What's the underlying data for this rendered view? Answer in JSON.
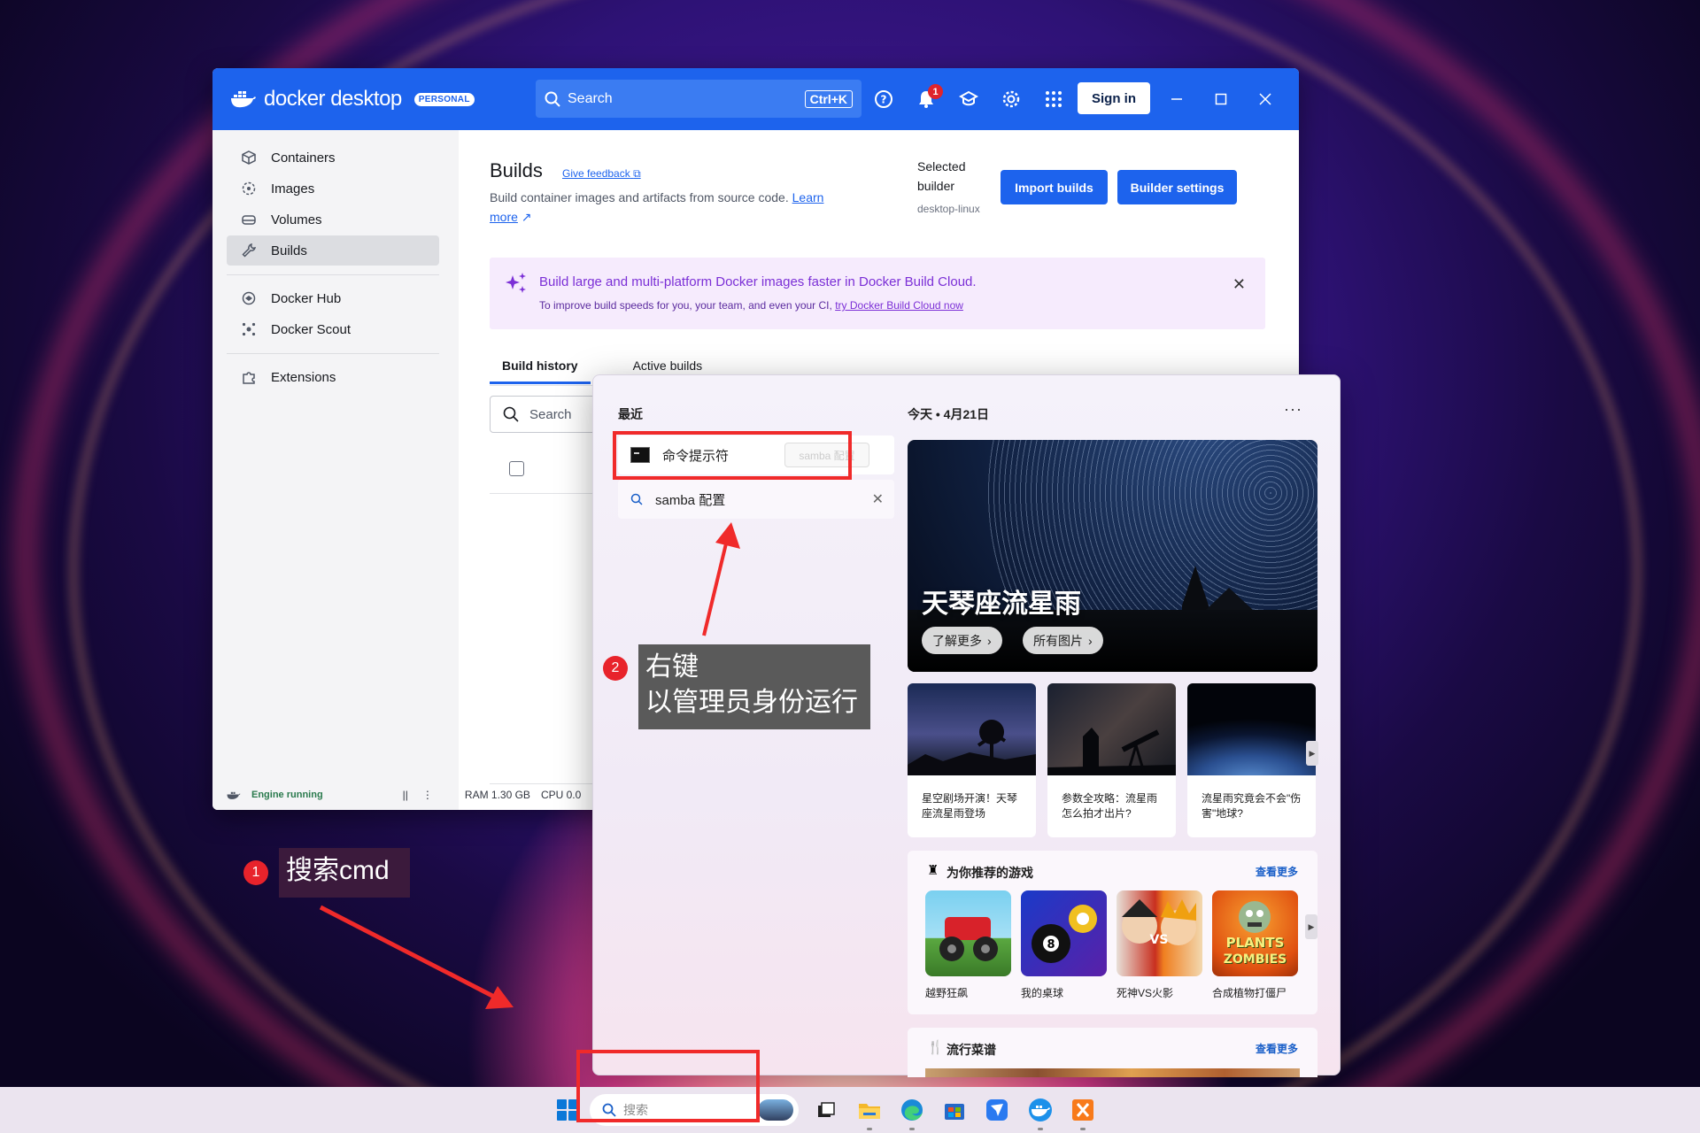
{
  "docker": {
    "logo_text": "docker desktop",
    "badge": "PERSONAL",
    "search_label": "Search",
    "search_shortcut": "Ctrl+K",
    "notification_count": "1",
    "signin_label": "Sign in",
    "sidebar": [
      {
        "label": "Containers",
        "icon": "container-icon"
      },
      {
        "label": "Images",
        "icon": "images-icon"
      },
      {
        "label": "Volumes",
        "icon": "volumes-icon"
      },
      {
        "label": "Builds",
        "icon": "builds-wrench-icon",
        "active": true
      },
      {
        "label": "Docker Hub",
        "icon": "docker-hub-icon"
      },
      {
        "label": "Docker Scout",
        "icon": "docker-scout-icon"
      },
      {
        "label": "Extensions",
        "icon": "extensions-puzzle-icon"
      }
    ],
    "status": {
      "engine": "Engine running",
      "pause": "||",
      "menu": "⋮",
      "ram": "RAM 1.30 GB",
      "cpu": "CPU 0.0"
    },
    "builds": {
      "title": "Builds",
      "feedback": "Give feedback",
      "desc_text": "Build container images and artifacts from source code.",
      "learn_more": "Learn more",
      "selected_builder_label": "Selected builder",
      "selected_builder_value": "desktop-linux",
      "import_btn": "Import builds",
      "settings_btn": "Builder settings",
      "banner_title": "Build large and multi-platform Docker images faster in Docker Build Cloud.",
      "banner_sub": "To improve build speeds for you, your team, and even your CI,",
      "banner_link": "try Docker Build Cloud now",
      "tabs": [
        "Build history",
        "Active builds"
      ],
      "search_placeholder": "Search"
    }
  },
  "start": {
    "recent_label": "最近",
    "recent_items": [
      "命令提示符",
      "samba 配置"
    ],
    "ghost_text": "samba 配置",
    "date_label": "今天 • 4月21日",
    "hero_title": "天琴座流星雨",
    "hero_buttons": [
      "了解更多",
      "所有图片"
    ],
    "cards": [
      {
        "text": "星空剧场开演！天琴座流星雨登场"
      },
      {
        "text": "参数全攻略：流星雨怎么拍才出片?"
      },
      {
        "text": "流星雨究竟会不会\"伤害\"地球?"
      }
    ],
    "games_title": "为你推荐的游戏",
    "games_more": "查看更多",
    "games": [
      "越野狂飙",
      "我的桌球",
      "死神VS火影",
      "合成植物打僵尸"
    ],
    "game_tile_text": [
      "PLANTS",
      "ZOMBIES"
    ],
    "recipes_title": "流行菜谱",
    "recipes_more": "查看更多"
  },
  "taskbar": {
    "search_placeholder": "搜索"
  },
  "annotations": {
    "step1_num": "1",
    "step1_text": "搜索cmd",
    "step2_num": "2",
    "step2_line1": "右键",
    "step2_line2": "以管理员身份运行"
  },
  "colors": {
    "docker_blue": "#1d63ed",
    "highlight_red": "#f02a2a",
    "annotation_red": "#e8232b"
  }
}
